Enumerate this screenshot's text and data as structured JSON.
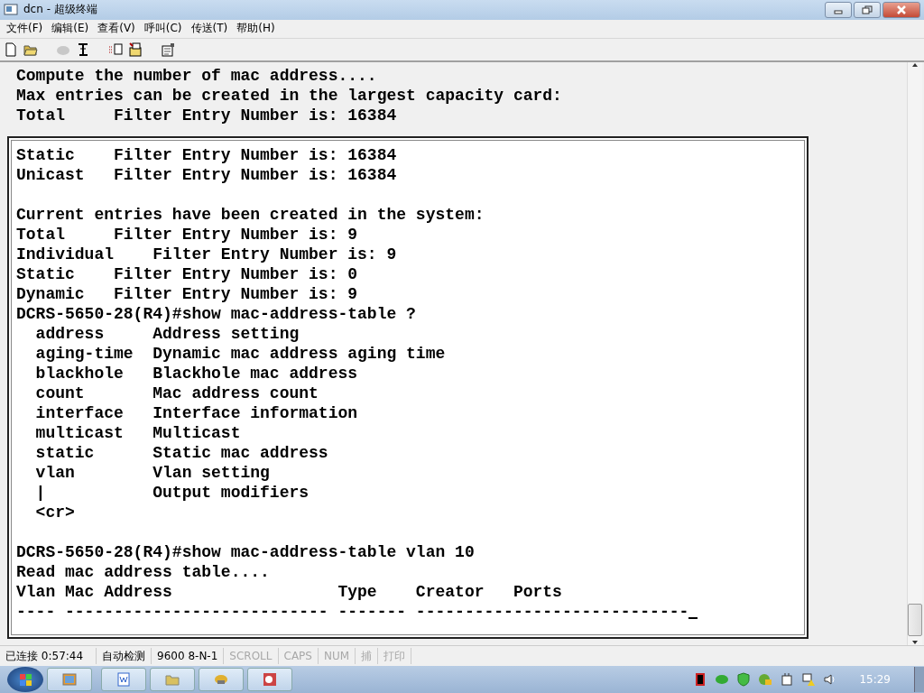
{
  "window": {
    "title": "dcn - 超级终端"
  },
  "menu": [
    "文件(F)",
    "编辑(E)",
    "查看(V)",
    "呼叫(C)",
    "传送(T)",
    "帮助(H)"
  ],
  "terminal": {
    "lines": [
      {
        "kind": "text",
        "text": "Compute the number of mac address...."
      },
      {
        "kind": "text",
        "text": "Max entries can be created in the largest capacity card:"
      },
      {
        "kind": "text",
        "text": "Total     Filter Entry Number is: 16384"
      }
    ],
    "panel": {
      "cursor": true,
      "lines": [
        {
          "kind": "text",
          "text": "Static    Filter Entry Number is: 16384"
        },
        {
          "kind": "text",
          "text": "Unicast   Filter Entry Number is: 16384"
        },
        {
          "kind": "blank"
        },
        {
          "kind": "text",
          "text": "Current entries have been created in the system:"
        },
        {
          "kind": "text",
          "text": "Total     Filter Entry Number is: 9"
        },
        {
          "kind": "text",
          "text": "Individual    Filter Entry Number is: 9"
        },
        {
          "kind": "text",
          "text": "Static    Filter Entry Number is: 0"
        },
        {
          "kind": "text",
          "text": "Dynamic   Filter Entry Number is: 9"
        },
        {
          "kind": "text",
          "text": "DCRS-5650-28(R4)#show mac-address-table ?"
        },
        {
          "kind": "text",
          "text": "  address     Address setting"
        },
        {
          "kind": "text",
          "text": "  aging-time  Dynamic mac address aging time"
        },
        {
          "kind": "text",
          "text": "  blackhole   Blackhole mac address"
        },
        {
          "kind": "text",
          "text": "  count       Mac address count"
        },
        {
          "kind": "text",
          "text": "  interface   Interface information"
        },
        {
          "kind": "text",
          "text": "  multicast   Multicast"
        },
        {
          "kind": "text",
          "text": "  static      Static mac address"
        },
        {
          "kind": "text",
          "text": "  vlan        Vlan setting"
        },
        {
          "kind": "text",
          "text": "  |           Output modifiers"
        },
        {
          "kind": "text",
          "text": "  <cr>"
        },
        {
          "kind": "blank"
        },
        {
          "kind": "text",
          "text": "DCRS-5650-28(R4)#show mac-address-table vlan 10"
        },
        {
          "kind": "text",
          "text": "Read mac address table...."
        },
        {
          "kind": "text",
          "text": "Vlan Mac Address                 Type    Creator   Ports"
        },
        {
          "kind": "text",
          "text": "---- --------------------------- ------- ----------------------------"
        }
      ]
    }
  },
  "status_bar": [
    {
      "text": "已连接 0:57:44",
      "disabled": false
    },
    {
      "text": "自动检测",
      "disabled": false
    },
    {
      "text": "9600 8-N-1",
      "disabled": false
    },
    {
      "text": "SCROLL",
      "disabled": true
    },
    {
      "text": "CAPS",
      "disabled": true
    },
    {
      "text": "NUM",
      "disabled": true
    },
    {
      "text": "捕",
      "disabled": true
    },
    {
      "text": "打印",
      "disabled": true
    }
  ],
  "taskbar": {
    "clock": "15:29"
  }
}
